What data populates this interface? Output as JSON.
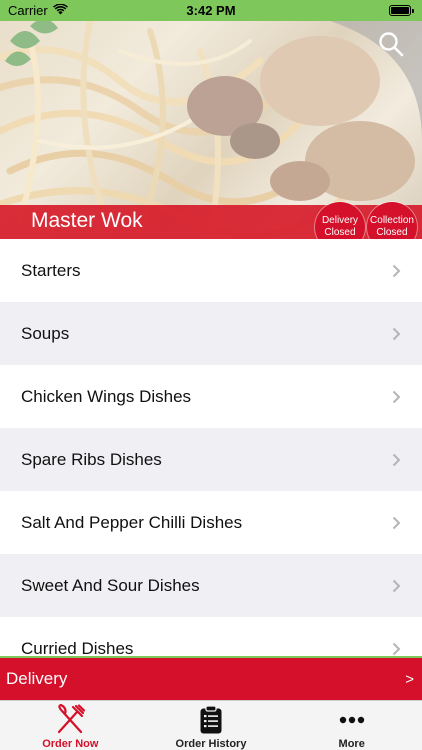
{
  "status_bar": {
    "carrier": "Carrier",
    "time": "3:42 PM",
    "bar_color": "#7ec85b",
    "icons": [
      "wifi-icon",
      "battery-icon"
    ]
  },
  "header": {
    "restaurant_name": "Master Wok",
    "search_icon": "search-icon",
    "delivery_status": {
      "line1": "Delivery",
      "line2": "Closed"
    },
    "collection_status": {
      "line1": "Collection",
      "line2": "Closed"
    },
    "accent_color": "#d4102a"
  },
  "categories": [
    {
      "label": "Starters"
    },
    {
      "label": "Soups"
    },
    {
      "label": "Chicken Wings Dishes"
    },
    {
      "label": "Spare Ribs Dishes"
    },
    {
      "label": "Salt And Pepper Chilli Dishes"
    },
    {
      "label": "Sweet And Sour Dishes"
    },
    {
      "label": "Curried Dishes"
    }
  ],
  "delivery_bar": {
    "label": "Delivery",
    "arrow": ">"
  },
  "tab_bar": {
    "tabs": [
      {
        "label": "Order Now",
        "icon": "fork-knife-icon",
        "active": true
      },
      {
        "label": "Order History",
        "icon": "clipboard-list-icon",
        "active": false
      },
      {
        "label": "More",
        "icon": "more-dots-icon",
        "active": false
      }
    ]
  }
}
